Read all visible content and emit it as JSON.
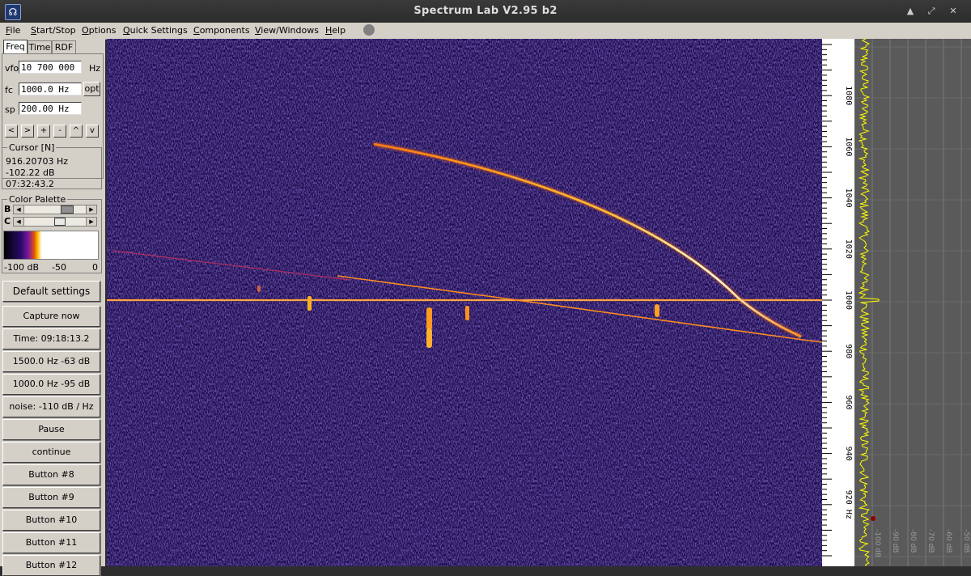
{
  "window": {
    "title": "Spectrum Lab V2.95 b2"
  },
  "menu": [
    "File",
    "Start/Stop",
    "Options",
    "Quick Settings",
    "Components",
    "View/Windows",
    "Help"
  ],
  "tabs": [
    "Freq",
    "Time",
    "RDF"
  ],
  "freq": {
    "vfo_label": "vfo",
    "vfo_value": "10 700 000",
    "vfo_unit": "Hz",
    "fc_label": "fc",
    "fc_value": "1000.0 Hz",
    "opt_label": "opt",
    "sp_label": "sp",
    "sp_value": "200.00 Hz",
    "step_buttons": [
      "<",
      ">",
      "+",
      "-",
      "^",
      "v"
    ]
  },
  "cursor": {
    "title": "Cursor [N]",
    "freq": "916.20703 Hz",
    "level": "-102.22 dB",
    "time": "07:32:43.2"
  },
  "palette": {
    "title": "Color Palette",
    "b_label": "B",
    "c_label": "C",
    "scale": [
      "-100 dB",
      "-50",
      "0"
    ]
  },
  "buttons": [
    "Default settings",
    "Capture now",
    "Time:  09:18:13.2",
    "1500.0 Hz  -63 dB",
    "1000.0 Hz  -95 dB",
    "noise: -110 dB / Hz",
    "Pause",
    "continue",
    "Button #8",
    "Button #9",
    "Button #10",
    "Button #11",
    "Button #12"
  ],
  "freq_scale": {
    "ticks": [
      {
        "value": 1080,
        "label": "1080"
      },
      {
        "value": 1060,
        "label": "1060"
      },
      {
        "value": 1040,
        "label": "1040"
      },
      {
        "value": 1020,
        "label": "1020"
      },
      {
        "value": 1000,
        "label": "1000"
      },
      {
        "value": 980,
        "label": "980"
      },
      {
        "value": 960,
        "label": "960"
      },
      {
        "value": 940,
        "label": "940"
      },
      {
        "value": 920,
        "label": "920 Hz"
      }
    ]
  },
  "spectrum_scale": [
    "-100 dB",
    "-90 dB",
    "-80 dB",
    "-70 dB",
    "-60 dB",
    "-50 dB",
    "-40 dB",
    "-30 dB"
  ],
  "colors": {
    "trace": "#ffff00",
    "waterfall_bg": "#1a0d4a",
    "signal": "#ffa020"
  }
}
